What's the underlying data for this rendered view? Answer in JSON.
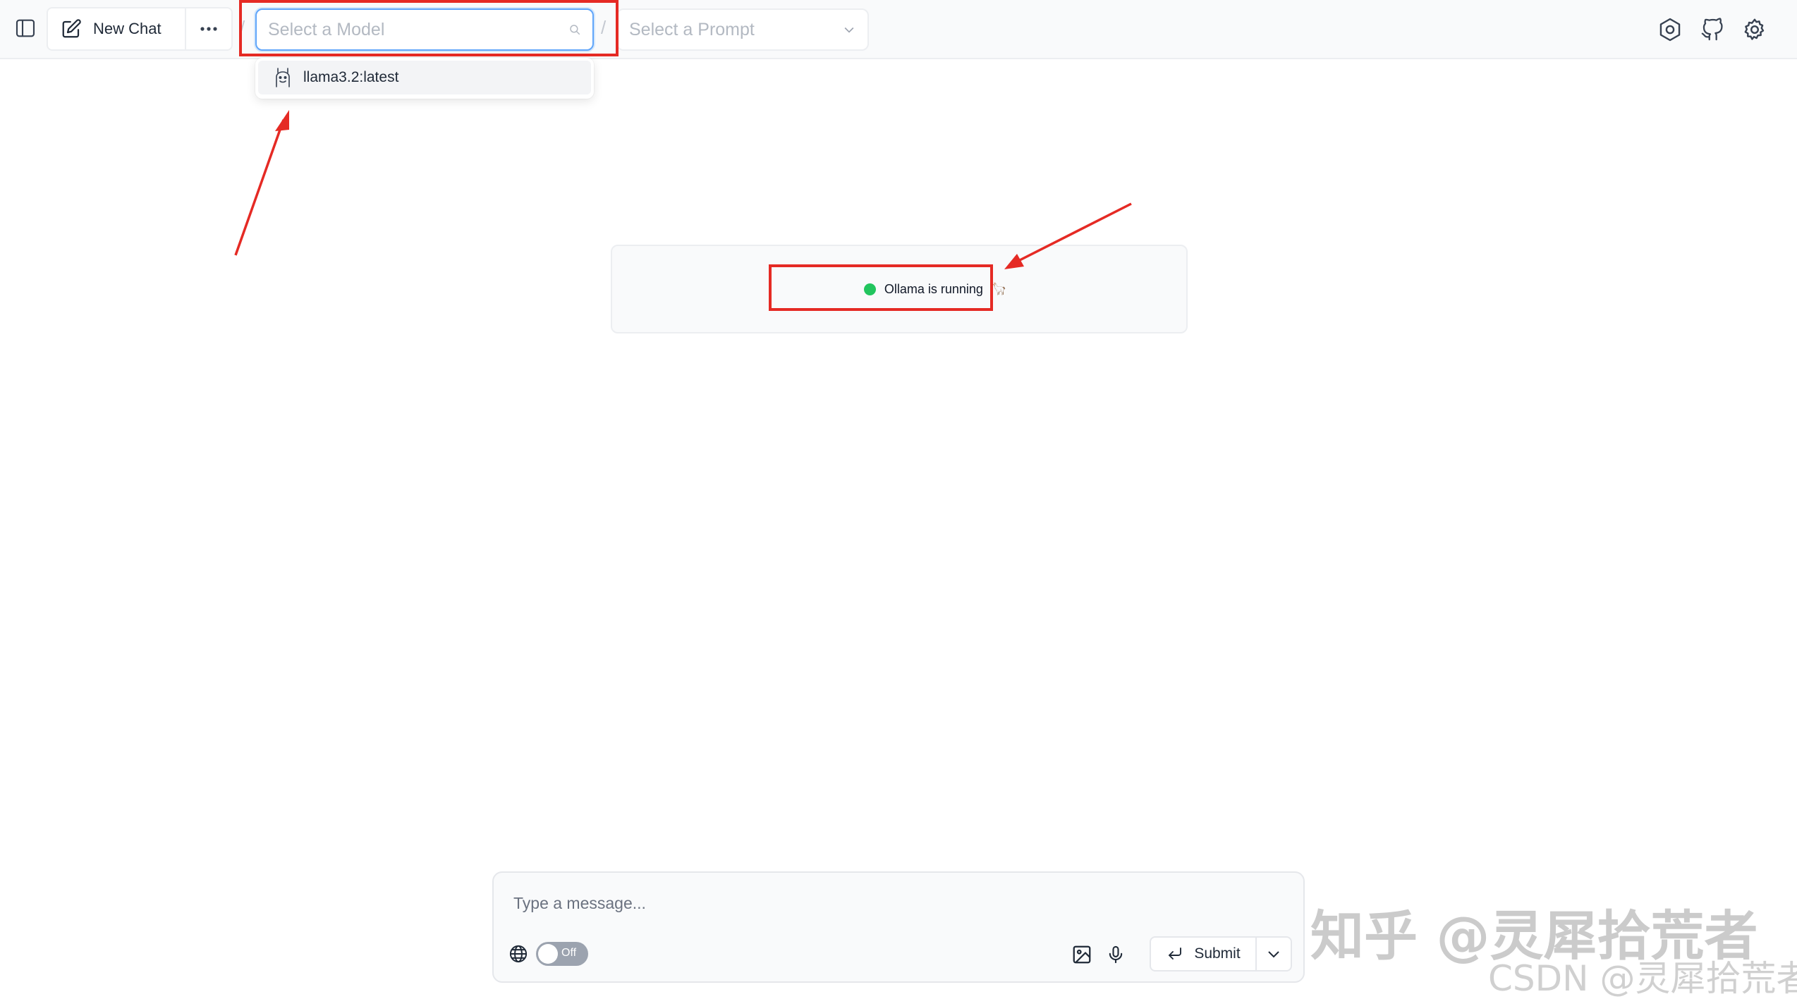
{
  "header": {
    "new_chat_label": "New Chat",
    "separator": "/",
    "model_select": {
      "placeholder": "Select a Model",
      "value": ""
    },
    "prompt_select": {
      "placeholder": "Select a Prompt"
    }
  },
  "model_dropdown": {
    "items": [
      {
        "label": "llama3.2:latest",
        "icon": "llama-icon",
        "highlighted": true
      }
    ]
  },
  "status": {
    "text": "Ollama is running",
    "emoji": "🦙",
    "indicator_color": "#22c55e"
  },
  "composer": {
    "placeholder": "Type a message...",
    "web_search_toggle": {
      "label": "Off",
      "state": false
    },
    "submit_label": "Submit"
  },
  "icons": {
    "sidebar": "sidebar-toggle-icon",
    "new_chat": "edit-icon",
    "more": "more-horizontal-icon",
    "search": "search-icon",
    "chevron": "chevron-down-icon",
    "header_right": [
      "settings-cog-icon",
      "github-icon",
      "gear-icon"
    ],
    "composer": [
      "globe-icon",
      "image-icon",
      "microphone-icon",
      "enter-icon",
      "chevron-down-icon"
    ]
  },
  "annotation_color": "#e52a24",
  "watermark": {
    "main": "知乎 @灵犀拾荒者",
    "sub": "CSDN @灵犀拾荒者"
  }
}
